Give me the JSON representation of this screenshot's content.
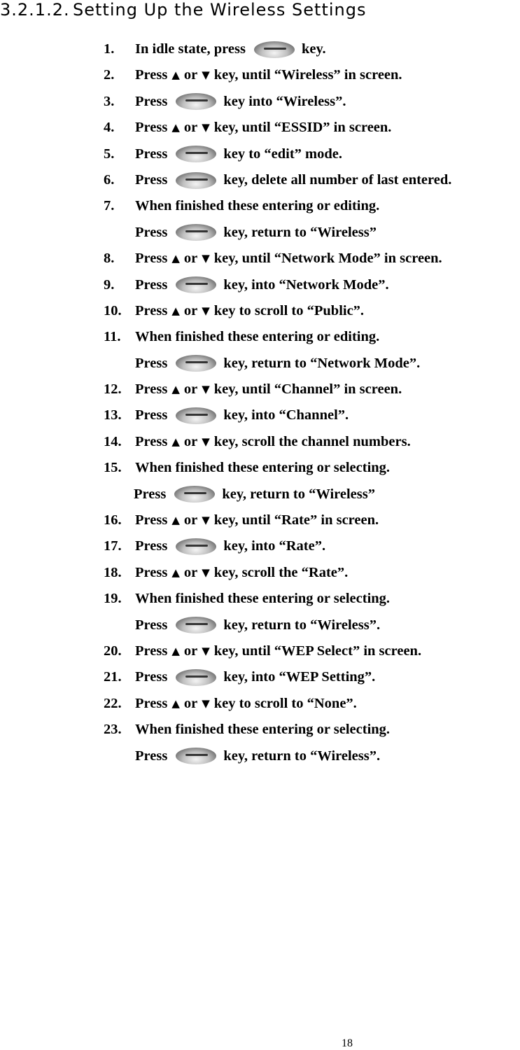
{
  "heading": {
    "number": "3.2.1.2.",
    "title": "Setting Up the Wireless Settings"
  },
  "icons": {
    "key": "oval-select-key-icon",
    "up": "▲",
    "down": "▼"
  },
  "steps": [
    {
      "n": "1.",
      "pre": "In idle state, press",
      "post": "key."
    },
    {
      "n": "2.",
      "pre": "Press",
      "mid": "or",
      "post": "key, until “Wireless” in screen."
    },
    {
      "n": "3.",
      "pre": "Press",
      "post": "key into “Wireless”."
    },
    {
      "n": "4.",
      "pre": "Press",
      "mid": "or",
      "post": "key, until “ESSID” in screen."
    },
    {
      "n": "5.",
      "pre": "Press",
      "post": "key to “edit” mode."
    },
    {
      "n": "6.",
      "pre": "Press",
      "post": "key, delete all number of last entered."
    },
    {
      "n": "7.",
      "text": "When finished these entering or editing.",
      "cont_pre": "Press",
      "cont_post": "key, return to “Wireless”"
    },
    {
      "n": "8.",
      "pre": "Press",
      "mid": "or",
      "post": "key, until “Network Mode” in screen."
    },
    {
      "n": "9.",
      "pre": "Press",
      "post": "key, into “Network Mode”."
    },
    {
      "n": "10.",
      "pre": "Press",
      "mid": "or",
      "post": "key to scroll to “Public”."
    },
    {
      "n": "11.",
      "text": "When finished these entering or editing.",
      "cont_pre": "Press",
      "cont_post": "key, return to “Network Mode”."
    },
    {
      "n": "12.",
      "pre": "Press",
      "mid": "or",
      "post": "key, until “Channel” in screen."
    },
    {
      "n": "13.",
      "pre": "Press",
      "post": "key, into “Channel”."
    },
    {
      "n": "14.",
      "pre": "Press",
      "mid": "or",
      "post": "key, scroll the channel numbers."
    },
    {
      "n": "15.",
      "text": "When finished these entering or selecting.",
      "cont_pre": "Press",
      "cont_post": "key, return to “Wireless”"
    },
    {
      "n": "16.",
      "pre": "Press",
      "mid": "or",
      "post": "key, until “Rate” in screen."
    },
    {
      "n": "17.",
      "pre": "Press",
      "post": "key, into “Rate”."
    },
    {
      "n": "18.",
      "pre": "Press",
      "mid": "or",
      "post": "key, scroll the “Rate”."
    },
    {
      "n": "19.",
      "text": "When finished these entering or selecting.",
      "cont_pre": "Press",
      "cont_post": "key, return to “Wireless”."
    },
    {
      "n": "20.",
      "pre": "Press",
      "mid": "or",
      "post": "key, until “WEP Select” in screen."
    },
    {
      "n": "21.",
      "pre": "Press",
      "post": "key, into “WEP Setting”."
    },
    {
      "n": "22.",
      "pre": "Press",
      "mid": "or",
      "post": "key to scroll to “None”."
    },
    {
      "n": "23.",
      "text": "When finished these entering or selecting.",
      "cont_pre": "Press",
      "cont_post": "key, return to “Wireless”."
    }
  ],
  "footer": {
    "page_number": "18"
  }
}
